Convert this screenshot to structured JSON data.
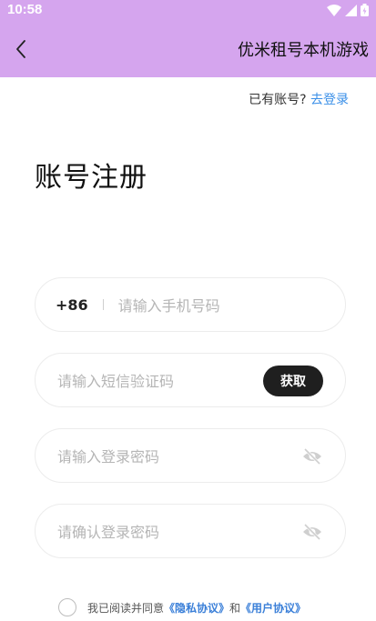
{
  "status": {
    "time": "10:58"
  },
  "appbar": {
    "title": "优米租号本机游戏"
  },
  "login": {
    "prompt": "已有账号?",
    "link": "去登录"
  },
  "page": {
    "title": "账号注册"
  },
  "form": {
    "phone": {
      "prefix": "+86",
      "placeholder": "请输入手机号码"
    },
    "code": {
      "placeholder": "请输入短信验证码",
      "button": "获取"
    },
    "password": {
      "placeholder": "请输入登录密码"
    },
    "confirm": {
      "placeholder": "请确认登录密码"
    }
  },
  "agreement": {
    "text": "我已阅读并同意",
    "privacy": "《隐私协议》",
    "and": "和",
    "user": "《用户协议》"
  },
  "colors": {
    "header": "#d5a5ee",
    "link": "#3a8fe8",
    "button": "#1f1f1f"
  }
}
